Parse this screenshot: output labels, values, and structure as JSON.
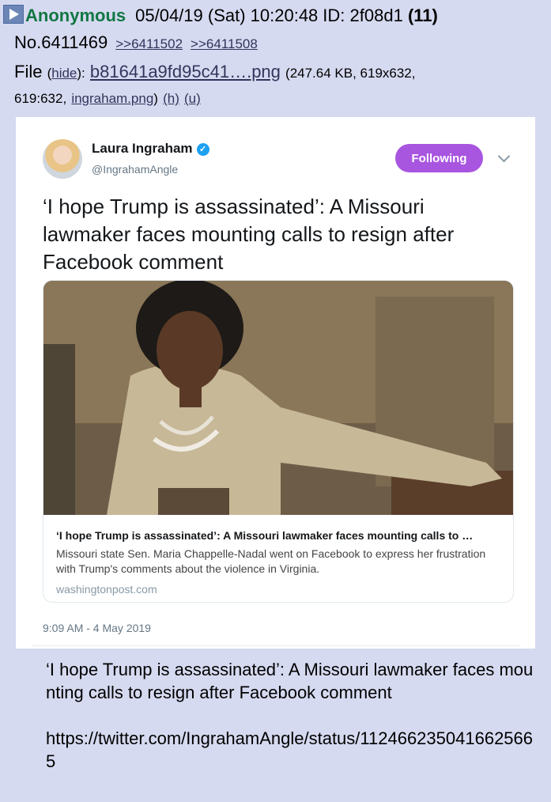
{
  "post": {
    "name": "Anonymous",
    "datetime": "05/04/19 (Sat) 10:20:48",
    "id_label": "ID: 2f08d1",
    "id_count": "(11)",
    "number": "No.6411469",
    "replies": [
      ">>6411502",
      ">>6411508"
    ],
    "file_label": "File",
    "hide_link": "hide",
    "filename": "b81641a9fd95c41….png",
    "file_info_1": "(247.64 KB, 619x632,",
    "file_info_2": "619:632,",
    "original_name": "ingraham.png",
    "h_link": "(h)",
    "u_link": "(u)",
    "message": "‘I hope Trump is assassinated’: A Missouri lawmaker faces mounting calls to resign after Facebook comment\n\nhttps://twitter.com/IngrahamAngle/status/1124662350416625665"
  },
  "tweet": {
    "user_name": "Laura Ingraham",
    "handle": "@IngrahamAngle",
    "follow_label": "Following",
    "text": "‘I hope Trump is assassinated’: A Missouri lawmaker faces mounting calls to resign after Facebook comment",
    "card_title": "‘I hope Trump is assassinated’: A Missouri lawmaker faces mounting calls to …",
    "card_desc": "Missouri state Sen. Maria Chappelle-Nadal went on Facebook to express her frustration with Trump's comments about the violence in Virginia.",
    "card_domain": "washingtonpost.com",
    "timestamp": "9:09 AM - 4 May 2019",
    "verified_icon": "check",
    "accent": "#a855e0"
  },
  "colors": {
    "board_bg": "#d6daf0",
    "name": "#117743",
    "link": "#34345c"
  }
}
